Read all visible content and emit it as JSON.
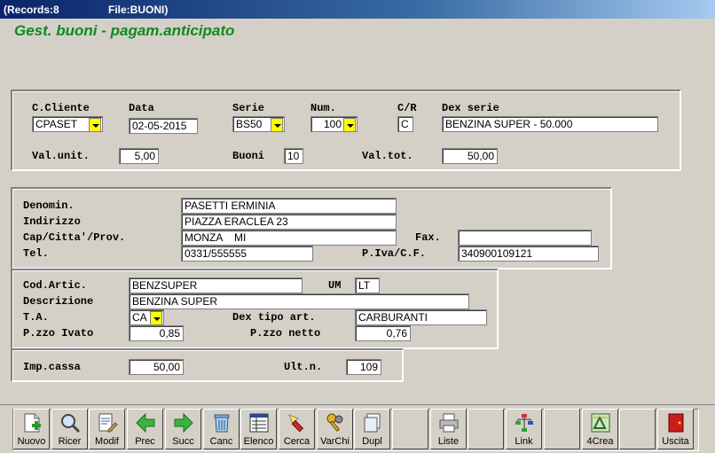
{
  "window": {
    "records": "(Records:8",
    "file": "File:BUONI)"
  },
  "heading": "Gest. buoni - pagam.anticipato",
  "labels": {
    "cliente": "C.Cliente",
    "data": "Data",
    "serie": "Serie",
    "num": "Num.",
    "cr": "C/R",
    "dex_serie": "Dex serie",
    "val_unit": "Val.unit.",
    "buoni": "Buoni",
    "val_tot": "Val.tot.",
    "denomin": "Denomin.",
    "indirizzo": "Indirizzo",
    "cap": "Cap/Citta'/Prov.",
    "fax": "Fax.",
    "tel": "Tel.",
    "piva": "P.Iva/C.F.",
    "cod_artic": "Cod.Artic.",
    "um": "UM",
    "descrizione": "Descrizione",
    "ta": "T.A.",
    "dex_tipo": "Dex tipo art.",
    "pzzo_ivato": "P.zzo Ivato",
    "pzzo_netto": "P.zzo netto",
    "imp_cassa": "Imp.cassa",
    "ult_n": "Ult.n."
  },
  "values": {
    "cliente": "CPASET",
    "data": "02-05-2015",
    "serie": "BS50",
    "num": "100",
    "cr": "C",
    "dex_serie": "BENZINA SUPER  - 50.000",
    "val_unit": "5,00",
    "buoni": "10",
    "val_tot": "50,00",
    "denomin": "PASETTI ERMINIA",
    "indirizzo": "PIAZZA ERACLEA 23",
    "cap": "MONZA    MI",
    "fax": "",
    "tel": "0331/555555",
    "piva": "340900109121",
    "cod_artic": "BENZSUPER",
    "um": "LT",
    "descrizione": "BENZINA SUPER",
    "ta": "CA",
    "dex_tipo": "CARBURANTI",
    "pzzo_ivato": "0,85",
    "pzzo_netto": "0,76",
    "imp_cassa": "50,00",
    "ult_n": "109"
  },
  "toolbar": [
    {
      "label": "Nuovo",
      "icon": "new-document-icon"
    },
    {
      "label": "Ricer",
      "icon": "magnifier-icon"
    },
    {
      "label": "Modif",
      "icon": "edit-document-icon"
    },
    {
      "label": "Prec",
      "icon": "arrow-left-icon"
    },
    {
      "label": "Succ",
      "icon": "arrow-right-icon"
    },
    {
      "label": "Canc",
      "icon": "trash-icon"
    },
    {
      "label": "Elenco",
      "icon": "list-icon"
    },
    {
      "label": "Cerca",
      "icon": "search-flashlight-icon"
    },
    {
      "label": "VarChi",
      "icon": "keys-icon"
    },
    {
      "label": "Dupl",
      "icon": "duplicate-icon"
    },
    {
      "label": "",
      "icon": ""
    },
    {
      "label": "Liste",
      "icon": "printer-icon"
    },
    {
      "label": "",
      "icon": ""
    },
    {
      "label": "Link",
      "icon": "link-tree-icon"
    },
    {
      "label": "",
      "icon": ""
    },
    {
      "label": "4Crea",
      "icon": "create-icon"
    },
    {
      "label": "",
      "icon": ""
    },
    {
      "label": "Uscita",
      "icon": "exit-door-icon"
    }
  ],
  "colors": {
    "heading": "#0f8a1f",
    "dropdown": "#ffff00",
    "titlebar": "#0a246a"
  }
}
